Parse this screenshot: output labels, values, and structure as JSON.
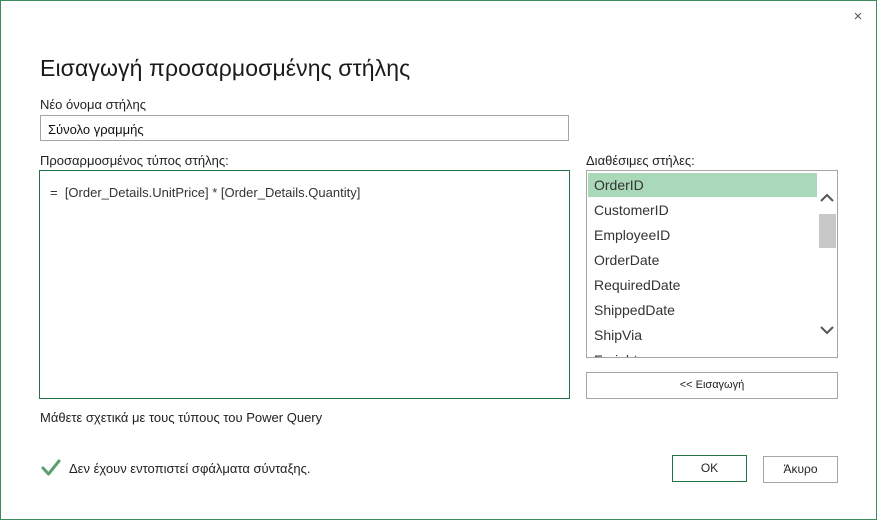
{
  "dialog": {
    "title": "Εισαγωγή προσαρμοσμένης στήλης",
    "close_symbol": "×"
  },
  "new_column": {
    "label": "Νέο όνομα στήλης",
    "value": "Σύνολο γραμμής"
  },
  "formula": {
    "label": "Προσαρμοσμένος τύπος στήλης:",
    "value": "=  [Order_Details.UnitPrice] * [Order_Details.Quantity]"
  },
  "available_columns": {
    "label": "Διαθέσιμες στήλες:",
    "items": [
      "OrderID",
      "CustomerID",
      "EmployeeID",
      "OrderDate",
      "RequiredDate",
      "ShippedDate",
      "ShipVia",
      "Freight"
    ],
    "selected": "OrderID",
    "insert_button": "<< Εισαγωγή"
  },
  "learn_link": "Μάθετε σχετικά με τους τύπους του Power Query",
  "status": {
    "text": "Δεν έχουν εντοπιστεί σφάλματα σύνταξης.",
    "icon": "checkmark-icon",
    "color": "#5aa06e"
  },
  "buttons": {
    "ok": "OK",
    "cancel": "Άκυρο"
  },
  "colors": {
    "accent": "#217346",
    "selection": "#a9d9b9"
  }
}
